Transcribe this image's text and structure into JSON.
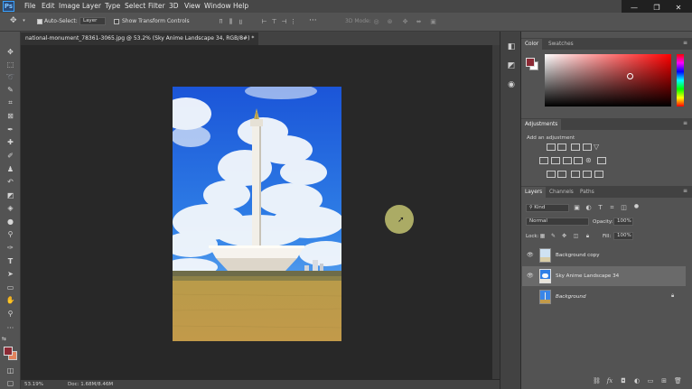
{
  "app": {
    "logo": "Ps"
  },
  "menu": [
    "File",
    "Edit",
    "Image",
    "Layer",
    "Type",
    "Select",
    "Filter",
    "3D",
    "View",
    "Window",
    "Help"
  ],
  "window_controls": {
    "minimize": "—",
    "maximize": "❐",
    "close": "✕"
  },
  "options_bar": {
    "auto_select_label": "Auto-Select:",
    "auto_select_target": "Layer",
    "transform_controls_label": "Show Transform Controls",
    "mode_3d_label": "3D Mode:"
  },
  "document": {
    "tab_title": "national-monument_78361-3065.jpg @ 53.2% (Sky Anime Landscape 34, RGB/8#) *",
    "close": "×"
  },
  "status": {
    "zoom": "53.19%",
    "doc_info": "Doc: 1.68M/8.46M"
  },
  "color_panel": {
    "tabs": [
      "Color",
      "Swatches"
    ],
    "foreground": "#8c2a35",
    "background": "#ffffff",
    "field_hue": "#ff0000"
  },
  "adjustments_panel": {
    "title": "Adjustments",
    "subtitle": "Add an adjustment"
  },
  "layers_panel": {
    "tabs": [
      "Layers",
      "Channels",
      "Paths"
    ],
    "filter_label": "Kind",
    "blend_mode": "Normal",
    "opacity_label": "Opacity:",
    "opacity_value": "100%",
    "lock_label": "Lock:",
    "fill_label": "Fill:",
    "fill_value": "100%",
    "layers": [
      {
        "name": "Background copy",
        "visible": true,
        "selected": false,
        "italic": false,
        "locked": false
      },
      {
        "name": "Sky Anime Landscape 34",
        "visible": true,
        "selected": true,
        "italic": false,
        "locked": false
      },
      {
        "name": "Background",
        "visible": false,
        "selected": false,
        "italic": true,
        "locked": true
      }
    ]
  },
  "colors": {
    "ui_dark": "#282828",
    "panel": "#535353",
    "accent_blue": "#39a2ff",
    "cursor_highlight": "#d7d77a"
  }
}
